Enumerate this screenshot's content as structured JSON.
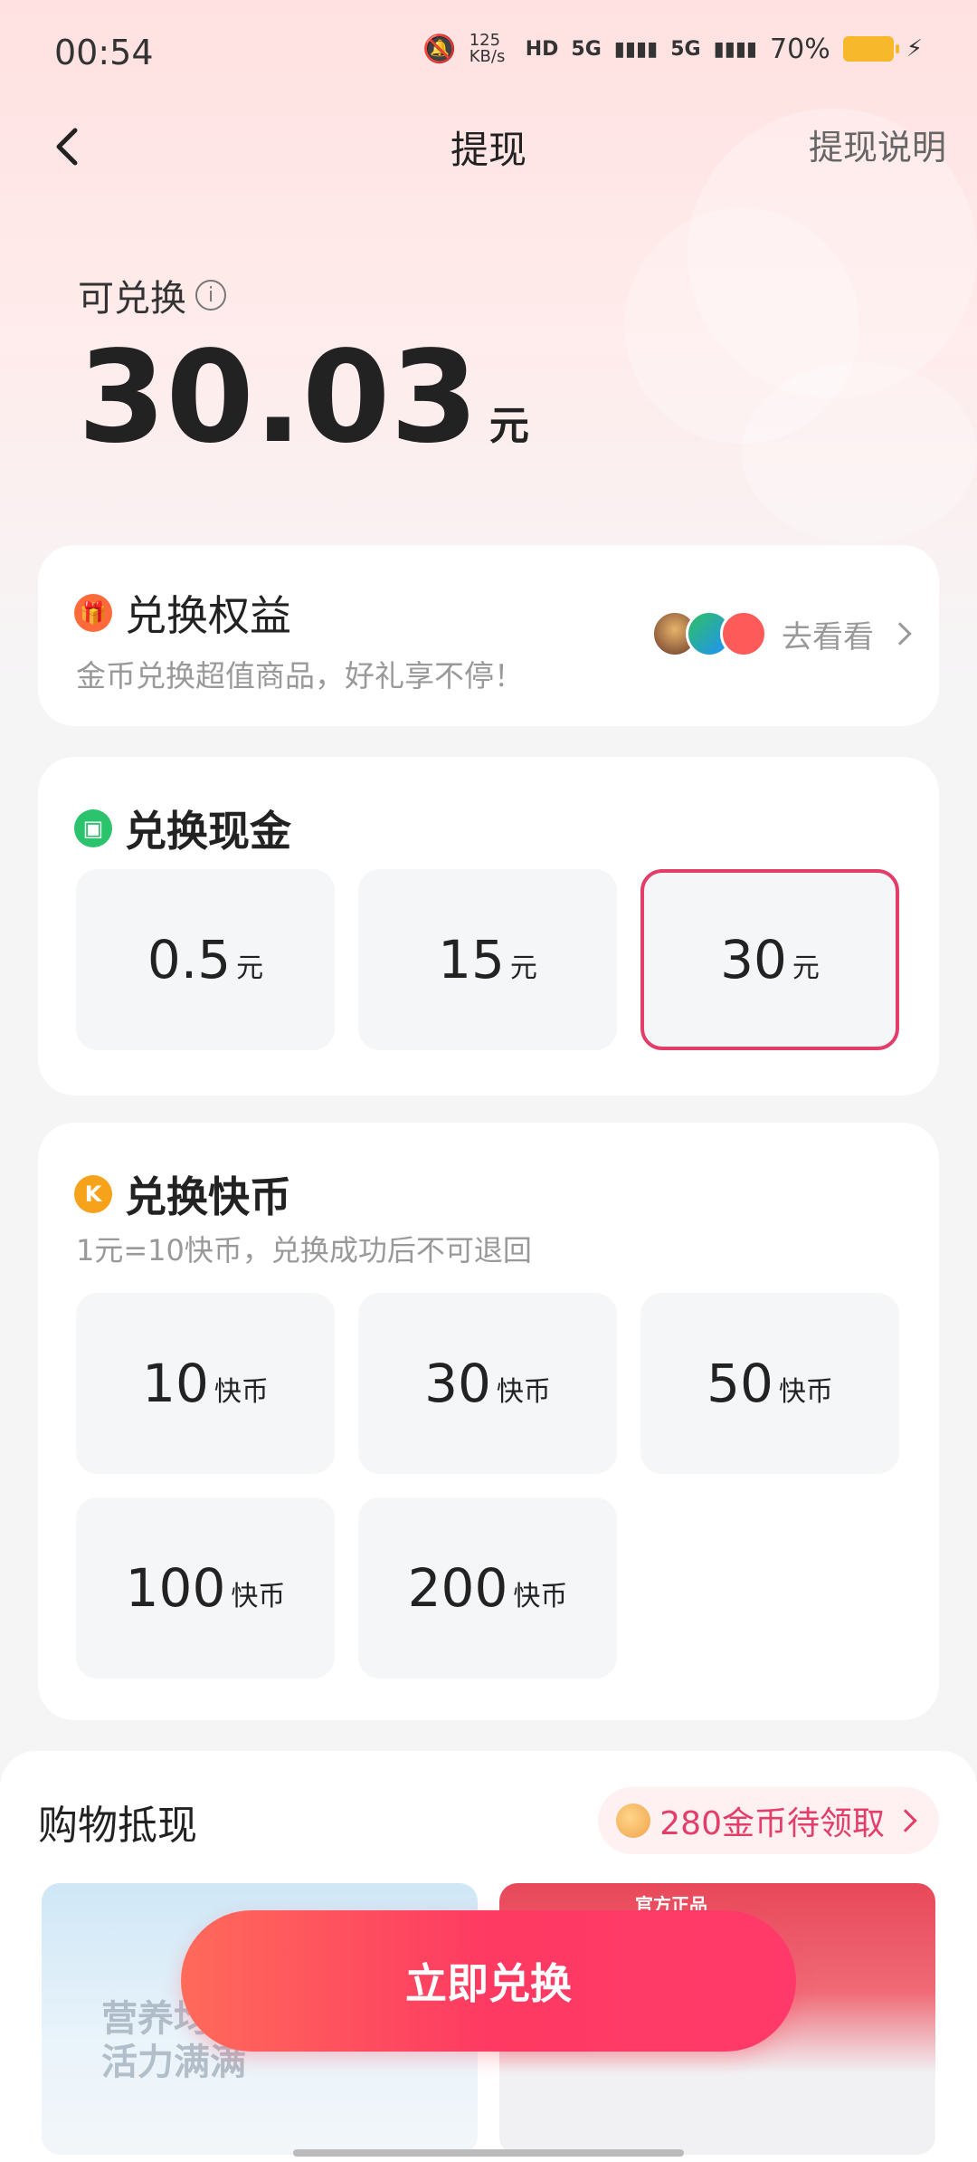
{
  "status_bar": {
    "time": "00:54",
    "net_speed": "125 KB/s",
    "signal_1": "5G",
    "signal_2": "5G",
    "battery": "70%"
  },
  "nav": {
    "title": "提现",
    "right_link": "提现说明"
  },
  "balance": {
    "label": "可兑换",
    "amount": "30.03",
    "unit": "元"
  },
  "benefits": {
    "title": "兑换权益",
    "subtitle": "金币兑换超值商品，好礼享不停！",
    "link": "去看看"
  },
  "cash": {
    "title": "兑换现金",
    "options": [
      {
        "value": "0.5",
        "unit": "元"
      },
      {
        "value": "15",
        "unit": "元"
      },
      {
        "value": "30",
        "unit": "元"
      }
    ],
    "selected_index": 2
  },
  "coins": {
    "title": "兑换快币",
    "subtitle": "1元=10快币，兑换成功后不可退回",
    "options": [
      {
        "value": "10",
        "unit": "快币"
      },
      {
        "value": "30",
        "unit": "快币"
      },
      {
        "value": "50",
        "unit": "快币"
      },
      {
        "value": "100",
        "unit": "快币"
      },
      {
        "value": "200",
        "unit": "快币"
      }
    ]
  },
  "shopping": {
    "title": "购物抵现",
    "pill": "280金币待领取",
    "product_1_text": "营养均\n活力满满",
    "product_2_tag": "官方正品"
  },
  "cta": {
    "label": "立即兑换"
  },
  "colors": {
    "accent": "#e23e69",
    "cta_start": "#ff6a5a",
    "cta_end": "#ff3a6a",
    "cash_icon": "#2bc36b",
    "coin_icon": "#f7a21b",
    "gift_icon": "#ff6a3a"
  }
}
